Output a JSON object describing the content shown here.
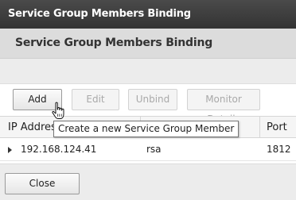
{
  "window": {
    "title": "Service Group Members Binding"
  },
  "header": {
    "title": "Service Group Members Binding"
  },
  "toolbar": {
    "add_label": "Add",
    "edit_label": "Edit",
    "unbind_label": "Unbind",
    "monitor_label": "Monitor Details"
  },
  "tooltip": {
    "text": "Create a new Service Group Member"
  },
  "grid": {
    "columns": {
      "ip": "IP Address",
      "port": "Port"
    },
    "rows": [
      {
        "ip": "192.168.124.41",
        "server": "rsa",
        "port": "1812"
      }
    ]
  },
  "footer": {
    "close_label": "Close"
  },
  "icons": {
    "expand": "expand-arrow-icon",
    "cursor": "hand-pointer-icon"
  }
}
